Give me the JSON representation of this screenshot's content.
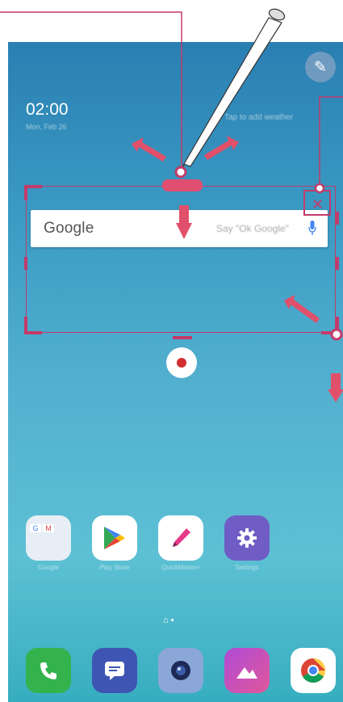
{
  "status": {
    "time": "02:00",
    "date": "Mon, Feb 26",
    "weather_hint": "Tap to add weather"
  },
  "google_widget": {
    "logo": "Google",
    "hint": "Say \"Ok Google\""
  },
  "apps": [
    {
      "label": "Google",
      "icon": "google-folder-icon"
    },
    {
      "label": "Play Store",
      "icon": "play-store-icon"
    },
    {
      "label": "QuickMemo+",
      "icon": "quickmemo-pen-icon"
    },
    {
      "label": "Settings",
      "icon": "settings-gear-icon"
    }
  ],
  "dock": [
    {
      "icon": "phone-icon"
    },
    {
      "icon": "messaging-icon"
    },
    {
      "icon": "camera-icon"
    },
    {
      "icon": "gallery-icon"
    },
    {
      "icon": "chrome-icon"
    }
  ],
  "colors": {
    "accent": "#c23b6a",
    "record": "#d32f2f",
    "arrow": "#e0506a"
  }
}
